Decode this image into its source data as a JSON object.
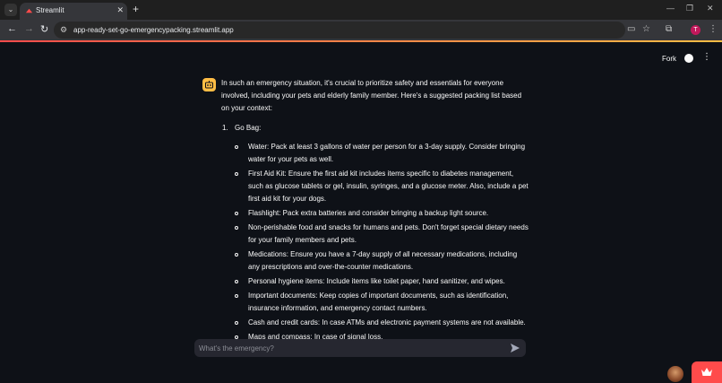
{
  "browser": {
    "tab_title": "Streamlit",
    "url": "app-ready-set-go-emergencypacking.streamlit.app",
    "profile_initial": "T"
  },
  "header": {
    "fork_label": "Fork"
  },
  "message": {
    "intro": "In such an emergency situation, it's crucial to prioritize safety and essentials for everyone involved, including your pets and elderly family member. Here's a suggested packing list based on your context:",
    "section_number": "1.",
    "section_title": "Go Bag:",
    "items": [
      "Water: Pack at least 3 gallons of water per person for a 3-day supply. Consider bringing water for your pets as well.",
      "First Aid Kit: Ensure the first aid kit includes items specific to diabetes management, such as glucose tablets or gel, insulin, syringes, and a glucose meter. Also, include a pet first aid kit for your dogs.",
      "Flashlight: Pack extra batteries and consider bringing a backup light source.",
      "Non-perishable food and snacks for humans and pets. Don't forget special dietary needs for your family members and pets.",
      "Medications: Ensure you have a 7-day supply of all necessary medications, including any prescriptions and over-the-counter medications.",
      "Personal hygiene items: Include items like toilet paper, hand sanitizer, and wipes.",
      "Important documents: Keep copies of important documents, such as identification, insurance information, and emergency contact numbers.",
      "Cash and credit cards: In case ATMs and electronic payment systems are not available.",
      "Maps and compass: In case of signal loss."
    ]
  },
  "chat_input": {
    "placeholder": "What's the emergency?"
  },
  "colors": {
    "background": "#0e1117",
    "accent": "#ff4b4b",
    "assistant_avatar": "#ffbd45"
  }
}
